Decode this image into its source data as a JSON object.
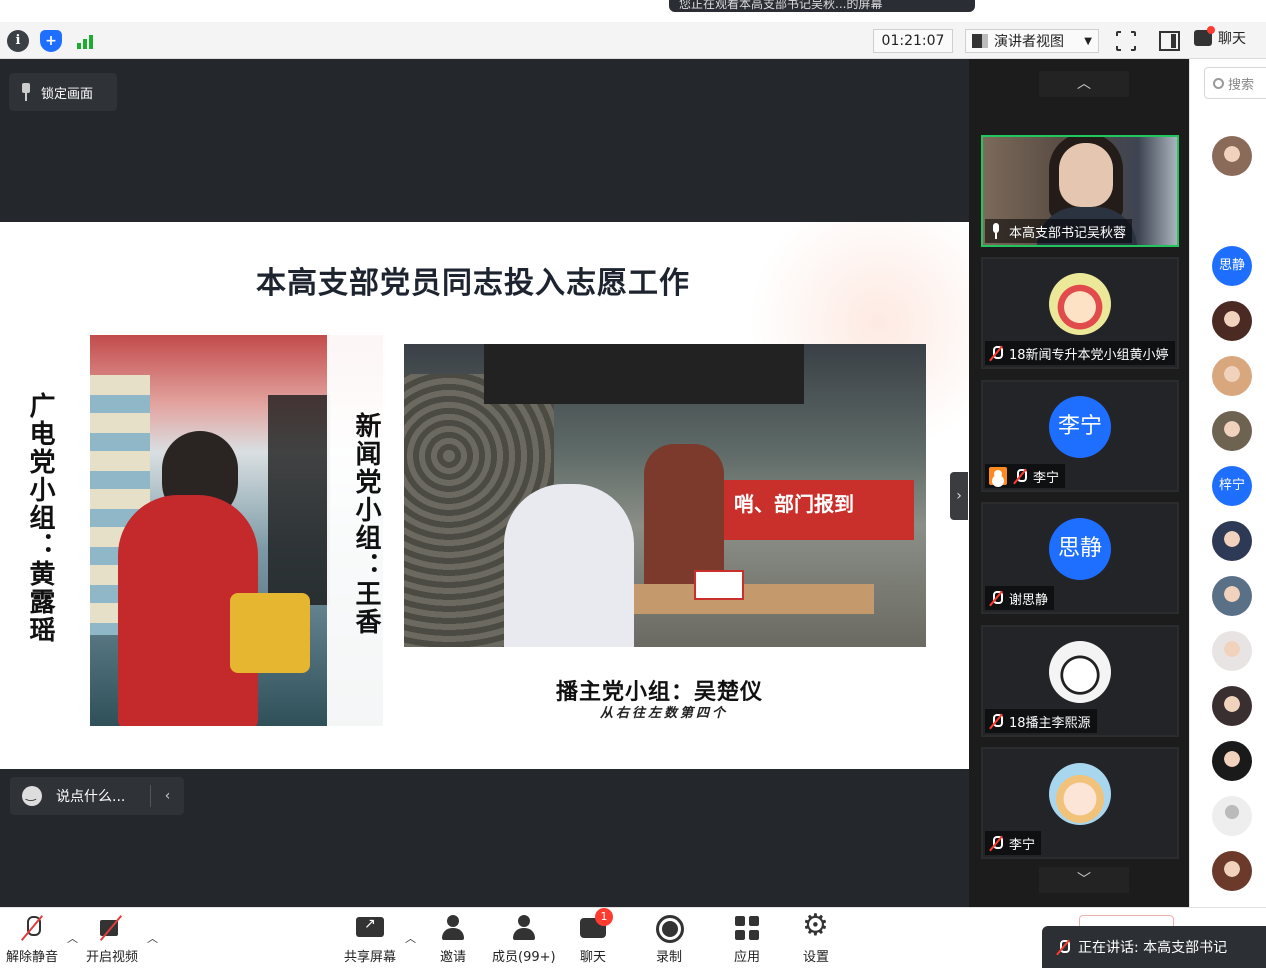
{
  "share_banner": "您正在观看本高支部书记吴秋...的屏幕",
  "toolbar": {
    "timer": "01:21:07",
    "view_mode": "演讲者视图",
    "chat_label": "聊天"
  },
  "stage": {
    "lock_label": "锁定画面",
    "comment_placeholder": "说点什么...",
    "slide": {
      "title": "本高支部党员同志投入志愿工作",
      "left_vertical": "广电党小组：黄露瑶",
      "mid_vertical": "新闻党小组：王香",
      "photo2_banner": "哨、部门报到",
      "caption": "播主党小组：吴楚仪",
      "subcaption": "从右往左数第四个"
    }
  },
  "participants": [
    {
      "name": "本高支部书记吴秋蓉",
      "avatar": "camera",
      "mic": "on",
      "active": true
    },
    {
      "name": "18新闻专升本党小组黄小婷",
      "avatar": "cartoon-red",
      "mic": "off"
    },
    {
      "name": "李宁",
      "avatar": "李宁",
      "mic": "off",
      "host_badge": true
    },
    {
      "name": "谢思静",
      "avatar": "思静",
      "mic": "off"
    },
    {
      "name": "18播主李熙源",
      "avatar": "cartoon-bw",
      "mic": "off"
    },
    {
      "name": "李宁",
      "avatar": "cartoon-hat",
      "mic": "off"
    }
  ],
  "member_panel": {
    "search_placeholder": "搜索",
    "members": [
      {
        "avatar": "photo",
        "initial": ""
      },
      {
        "avatar": "logo",
        "initial": ""
      },
      {
        "avatar": "blue",
        "initial": "思静"
      },
      {
        "avatar": "photo",
        "initial": ""
      },
      {
        "avatar": "photo",
        "initial": ""
      },
      {
        "avatar": "photo",
        "initial": ""
      },
      {
        "avatar": "blue",
        "initial": "梓宁"
      },
      {
        "avatar": "photo",
        "initial": ""
      },
      {
        "avatar": "photo",
        "initial": ""
      },
      {
        "avatar": "photo",
        "initial": ""
      },
      {
        "avatar": "photo",
        "initial": ""
      },
      {
        "avatar": "photo",
        "initial": ""
      },
      {
        "avatar": "placeholder",
        "initial": ""
      },
      {
        "avatar": "photo",
        "initial": ""
      }
    ]
  },
  "bottombar": {
    "unmute": "解除静音",
    "start_video": "开启视频",
    "share_screen": "共享屏幕",
    "invite": "邀请",
    "members": "成员(99+)",
    "chat": "聊天",
    "chat_badge": "1",
    "record": "录制",
    "apps": "应用",
    "settings": "设置"
  },
  "speaking_now": "正在讲话: 本高支部书记"
}
